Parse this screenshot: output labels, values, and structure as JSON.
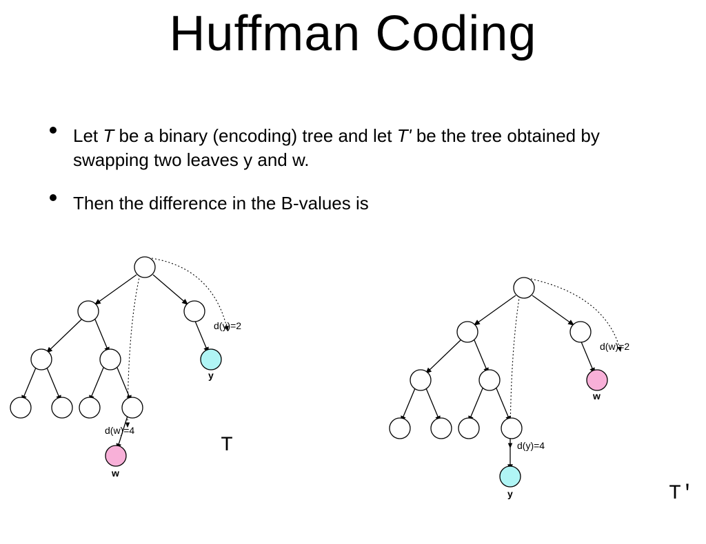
{
  "title": "Huffman Coding",
  "bullets": [
    {
      "pre": "Let ",
      "i1": "T",
      "mid1": " be a binary (encoding) tree and let ",
      "i2": "T'",
      "mid2": " be the tree obtained by swapping two leaves y and w."
    },
    {
      "pre": "Then the difference in the B-values is",
      "i1": "",
      "mid1": "",
      "i2": "",
      "mid2": ""
    }
  ],
  "tree_left": {
    "label": "T",
    "y_label": "y",
    "w_label": "w",
    "dy_label": "d(y)=2",
    "dw_label": "d(w)=4"
  },
  "tree_right": {
    "label": "T'",
    "y_label": "y",
    "w_label": "w",
    "dy_label": "d(y)=4",
    "dw_label": "d(w)=2"
  }
}
